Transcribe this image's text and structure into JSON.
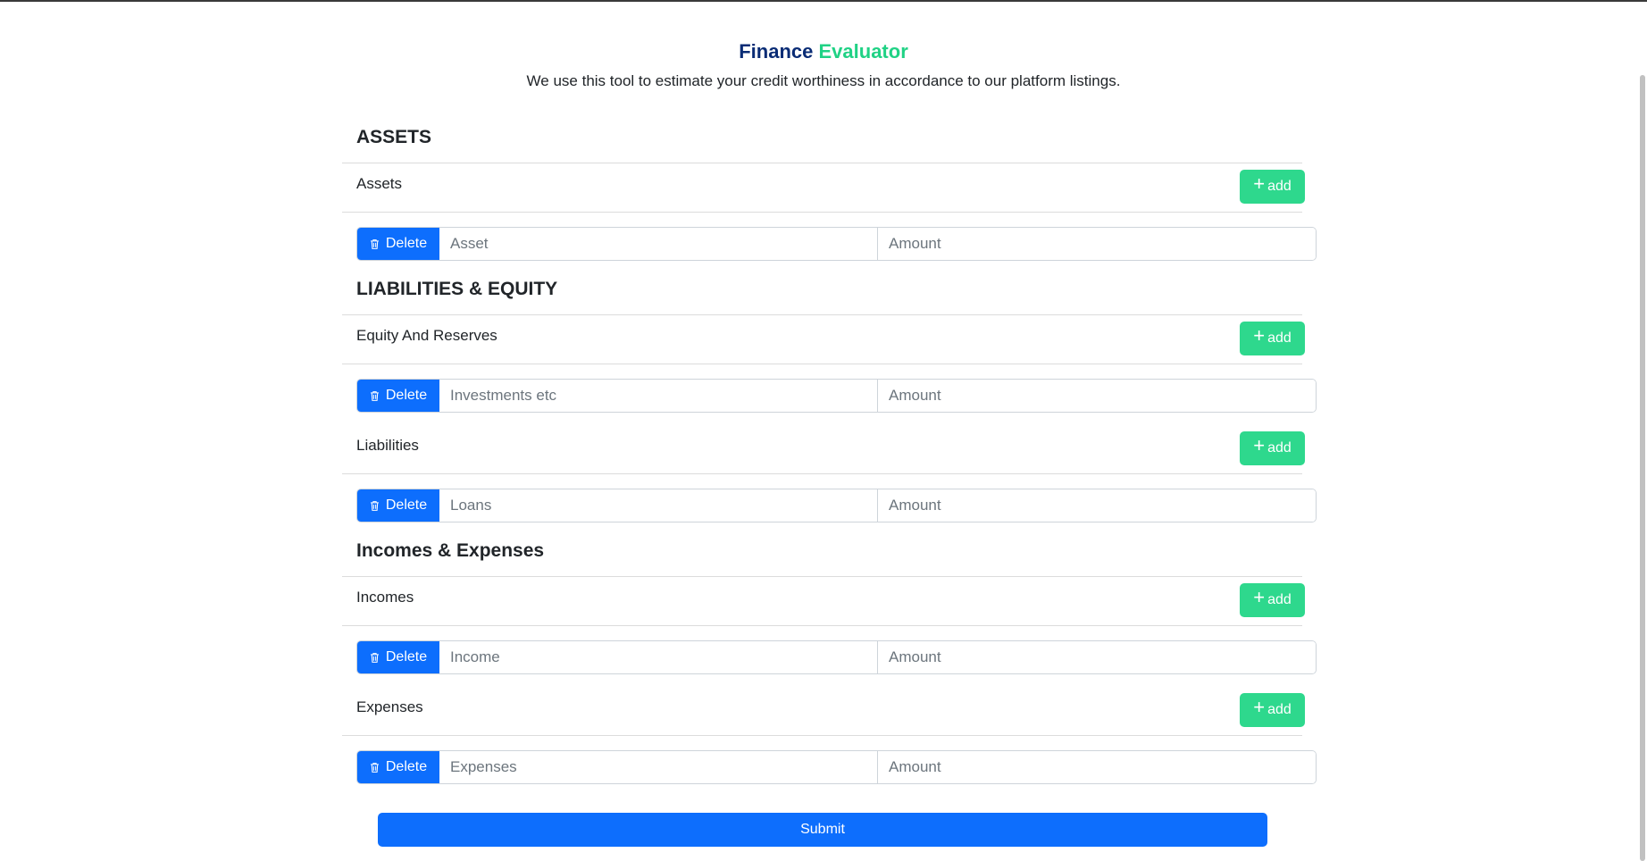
{
  "header": {
    "title_part1": "Finance",
    "title_part2": "Evaluator",
    "subtitle": "We use this tool to estimate your credit worthiness in accordance to our platform listings."
  },
  "colors": {
    "primary": "#0d6efd",
    "add_green": "#2ed88d",
    "title_navy": "#0a2c75",
    "title_green": "#20d285"
  },
  "assets": {
    "section_title": "ASSETS",
    "label": "Assets",
    "add_label": "add",
    "delete_label": "Delete",
    "name_placeholder": "Asset",
    "amount_placeholder": "Amount"
  },
  "liabilities_equity": {
    "section_title": "LIABILITIES & EQUITY",
    "equity": {
      "label": "Equity And Reserves",
      "add_label": "add",
      "delete_label": "Delete",
      "name_placeholder": "Investments etc",
      "amount_placeholder": "Amount"
    },
    "liabilities": {
      "label": "Liabilities",
      "add_label": "add",
      "delete_label": "Delete",
      "name_placeholder": "Loans",
      "amount_placeholder": "Amount"
    }
  },
  "incomes_expenses": {
    "section_title": "Incomes & Expenses",
    "incomes": {
      "label": "Incomes",
      "add_label": "add",
      "delete_label": "Delete",
      "name_placeholder": "Income",
      "amount_placeholder": "Amount"
    },
    "expenses": {
      "label": "Expenses",
      "add_label": "add",
      "delete_label": "Delete",
      "name_placeholder": "Expenses",
      "amount_placeholder": "Amount"
    }
  },
  "submit_label": "Submit"
}
